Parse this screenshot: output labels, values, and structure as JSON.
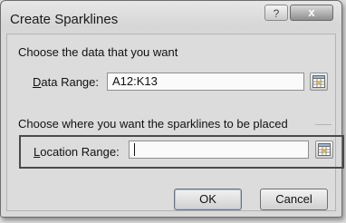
{
  "window": {
    "title": "Create Sparklines",
    "help_glyph": "?",
    "close_glyph": "x"
  },
  "data_section": {
    "heading": "Choose the data that you want",
    "data_range": {
      "label_accel": "D",
      "label_rest": "ata Range:",
      "value": "A12:K13"
    }
  },
  "location_section": {
    "heading": "Choose where you want the sparklines to be placed",
    "location_range": {
      "label_accel": "L",
      "label_rest": "ocation Range:",
      "value": ""
    }
  },
  "buttons": {
    "ok": "OK",
    "cancel": "Cancel"
  },
  "icons": {
    "range_picker": "range-select-icon"
  }
}
